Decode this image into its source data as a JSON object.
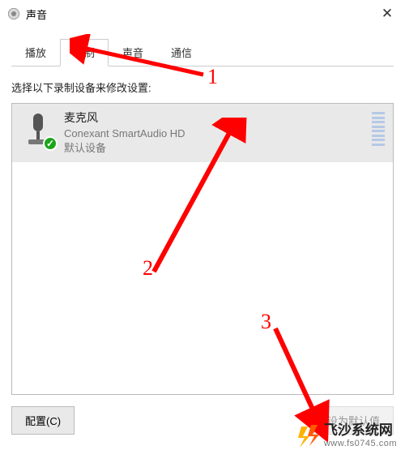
{
  "window": {
    "title": "声音",
    "close_glyph": "✕"
  },
  "tabs": {
    "items": [
      {
        "label": "播放",
        "active": false
      },
      {
        "label": "录制",
        "active": true
      },
      {
        "label": "声音",
        "active": false
      },
      {
        "label": "通信",
        "active": false
      }
    ]
  },
  "panel": {
    "instruction": "选择以下录制设备来修改设置:"
  },
  "device": {
    "name": "麦克风",
    "driver": "Conexant SmartAudio HD",
    "status": "默认设备"
  },
  "buttons": {
    "configure": "配置(C)",
    "set_default": "设为默认值"
  },
  "annotations": {
    "one": "1",
    "two": "2",
    "three": "3"
  },
  "watermark": {
    "name": "飞沙系统网",
    "url": "www.fs0745.com"
  }
}
